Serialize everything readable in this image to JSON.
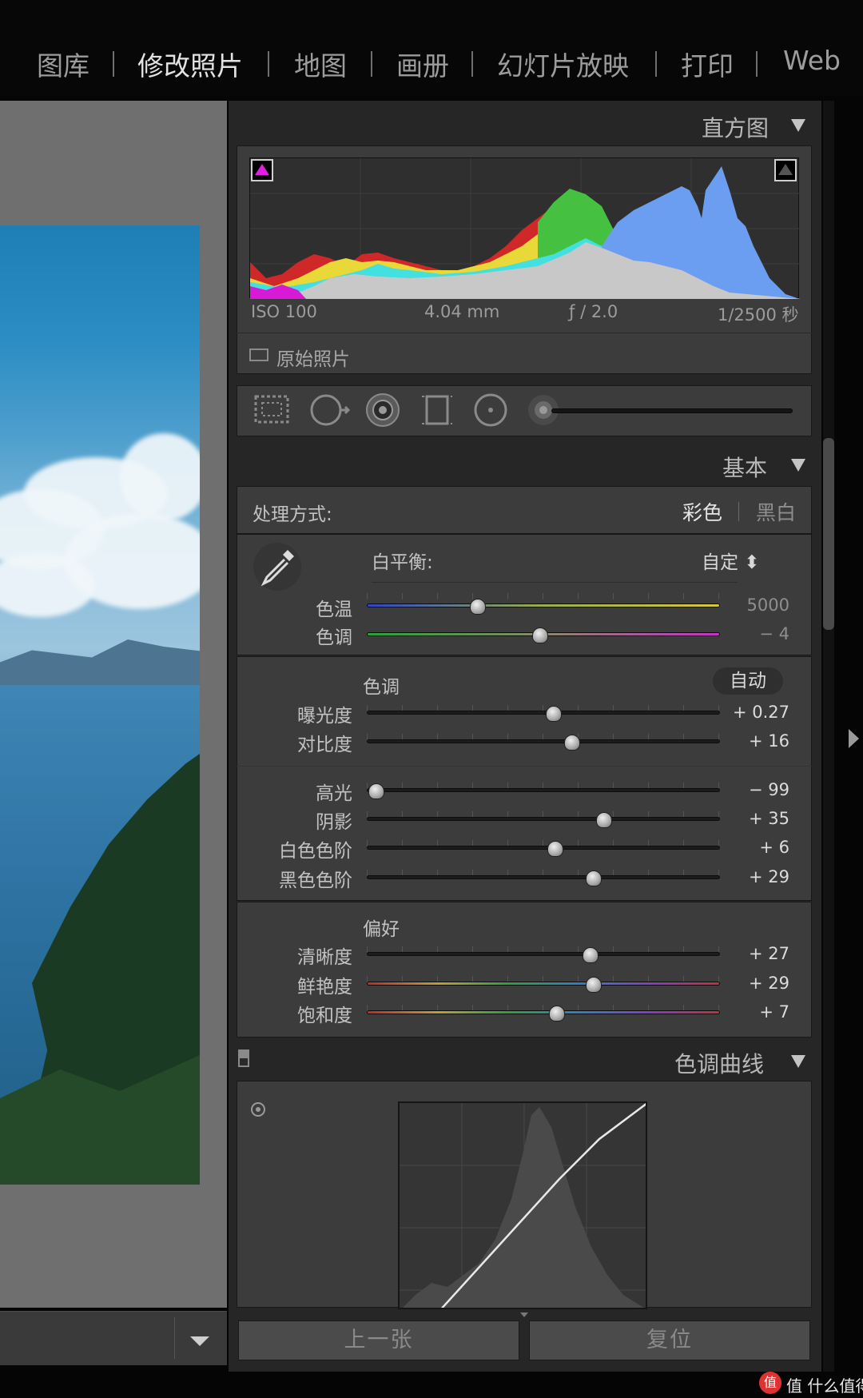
{
  "modules": {
    "library": "图库",
    "develop": "修改照片",
    "map": "地图",
    "book": "画册",
    "slideshow": "幻灯片放映",
    "print": "打印",
    "web": "Web"
  },
  "histogram": {
    "title": "直方图",
    "exif_iso": "ISO 100",
    "exif_focal": "4.04 mm",
    "exif_aperture": "ƒ / 2.0",
    "exif_shutter": "1/2500 秒",
    "original_photo": "原始照片"
  },
  "basic": {
    "title": "基本",
    "treatment_label": "处理方式:",
    "treatment_color": "彩色",
    "treatment_bw": "黑白",
    "wb_label": "白平衡:",
    "wb_value": "自定 ⬍",
    "temp_label": "色温",
    "temp_value": "5000",
    "tint_label": "色调",
    "tint_value": "− 4",
    "tone_section": "色调",
    "auto_label": "自动",
    "exposure_label": "曝光度",
    "exposure_value": "+ 0.27",
    "contrast_label": "对比度",
    "contrast_value": "+ 16",
    "highlights_label": "高光",
    "highlights_value": "− 99",
    "shadows_label": "阴影",
    "shadows_value": "+ 35",
    "whites_label": "白色色阶",
    "whites_value": "+ 6",
    "blacks_label": "黑色色阶",
    "blacks_value": "+ 29",
    "presence_section": "偏好",
    "clarity_label": "清晰度",
    "clarity_value": "+ 27",
    "vibrance_label": "鲜艳度",
    "vibrance_value": "+ 29",
    "saturation_label": "饱和度",
    "saturation_value": "+ 7"
  },
  "tone_curve": {
    "title": "色调曲线"
  },
  "bottom": {
    "previous": "上一张",
    "reset": "复位"
  },
  "watermark": {
    "text": "值 什么值得买",
    "badge": "值"
  },
  "icons": [
    "crop-overlay-icon",
    "spot-removal-icon",
    "red-eye-icon",
    "graduated-filter-icon",
    "radial-filter-icon",
    "adjustment-brush-icon",
    "eyedropper-icon",
    "target-adjust-icon"
  ],
  "colors": {
    "panel": "#3c3c3c",
    "background": "#262626",
    "accent_clip": "#d81ad8"
  }
}
